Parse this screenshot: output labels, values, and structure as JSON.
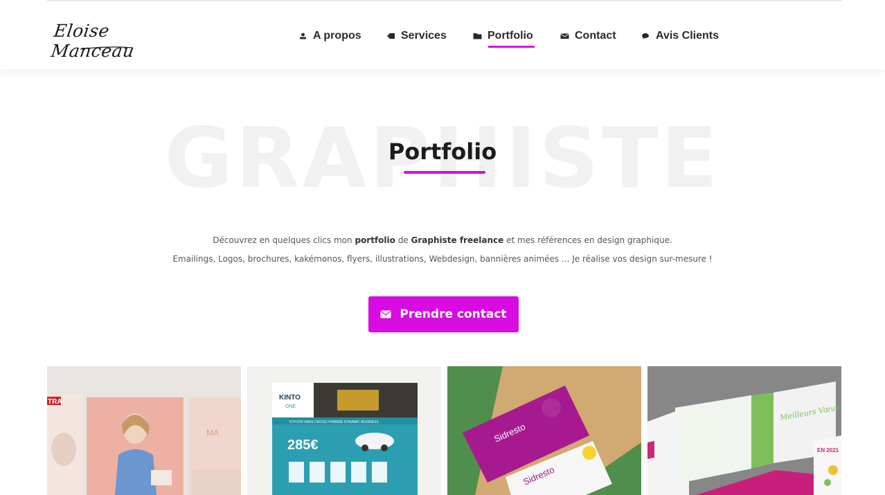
{
  "header": {
    "logo_text": "Eloise Manceau",
    "nav": [
      {
        "label": "A propos",
        "icon": "user-icon"
      },
      {
        "label": "Services",
        "icon": "tag-icon"
      },
      {
        "label": "Portfolio",
        "icon": "folder-icon",
        "active": true
      },
      {
        "label": "Contact",
        "icon": "envelope-icon"
      },
      {
        "label": "Avis Clients",
        "icon": "comments-icon"
      }
    ]
  },
  "hero": {
    "background_word": "GRAPHISTE",
    "title": "Portfolio",
    "desc_line1": {
      "part1": "Découvrez en quelques clics mon ",
      "bold1": "portfolio",
      "part2": " de ",
      "bold2": "Graphiste freelance",
      "part3": " et mes références en design graphique."
    },
    "desc_line2": "Emailings, Logos, brochures, kakémonos, flyers, illustrations, Webdesign, bannières animées ... Je réalise vos design sur-mesure !",
    "cta_label": "Prendre contact",
    "cta_icon": "envelope-icon"
  },
  "portfolio": {
    "tiles": [
      {
        "name": "magazine-tile",
        "texts": {
          "brand": "TRA",
          "side": "MA"
        }
      },
      {
        "name": "kinto-flyer-tile",
        "texts": {
          "brand": "KINTO",
          "sub": "ONE",
          "price": "285€",
          "banner": "TOYOTA YARIS CROSS HYBRIDE DYNAMIC BUSINESS"
        }
      },
      {
        "name": "sidresto-cards-tile",
        "texts": {
          "brand1": "Sidresto",
          "brand2": "Sidresto"
        }
      },
      {
        "name": "brochure-tile",
        "texts": {
          "script": "Meilleurs Vœux",
          "year": "EN 2021"
        }
      }
    ]
  },
  "colors": {
    "accent": "#d80ce0",
    "text": "#222222",
    "muted": "#555555"
  }
}
